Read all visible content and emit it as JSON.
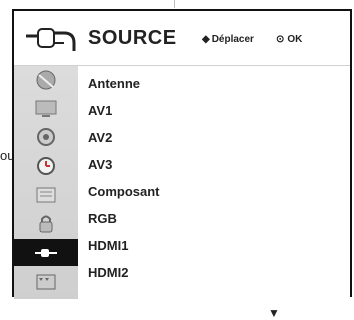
{
  "header": {
    "title": "SOURCE",
    "move_hint": "Déplacer",
    "ok_hint": "OK"
  },
  "side_text": "ou",
  "sidebar": {
    "items": [
      {
        "icon": "satellite-dish-icon"
      },
      {
        "icon": "tv-screen-icon"
      },
      {
        "icon": "speaker-icon"
      },
      {
        "icon": "clock-icon"
      },
      {
        "icon": "settings-box-icon"
      },
      {
        "icon": "lock-icon"
      },
      {
        "icon": "input-cable-icon",
        "active": true
      },
      {
        "icon": "usb-media-icon"
      }
    ]
  },
  "sources": [
    {
      "label": "Antenne"
    },
    {
      "label": "AV1"
    },
    {
      "label": "AV2"
    },
    {
      "label": "AV3"
    },
    {
      "label": "Composant"
    },
    {
      "label": "RGB"
    },
    {
      "label": "HDMI1"
    },
    {
      "label": "HDMI2"
    }
  ],
  "colors": {
    "sidebar_active": "#111111",
    "panel_border": "#111111"
  }
}
